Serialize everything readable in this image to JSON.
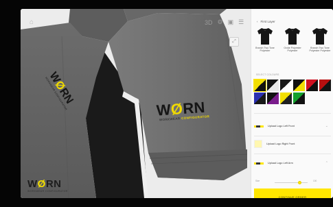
{
  "toolbar": {
    "home_icon": "home-icon",
    "tools": [
      "3D",
      "⚙",
      "▣",
      "☰"
    ],
    "expand_icon": "expand-icon"
  },
  "render": {
    "shirt_color": "#6e6e6e",
    "accent_color": "#1a1a1a",
    "piping_color": "#f2f2f2",
    "logo_main": {
      "name_pre": "W",
      "name_o": "Ø",
      "name_post": "RN",
      "tagline_pre": "WORKWEAR ",
      "tagline_post": "CONFIGURATOR"
    },
    "logo_side": {
      "name_pre": "W",
      "name_o": "Ø",
      "name_post": "RN",
      "tagline": "WORKWEAR CONFIGURATOR"
    }
  },
  "brand": {
    "name_pre": "W",
    "name_o": "Ø",
    "name_post": "RN",
    "tagline": "WORKWEAR CONFIGURATOR"
  },
  "panel": {
    "back_icon": "chevron-left-icon",
    "title": "First Layer",
    "styles": [
      {
        "label": "Branch Two Tone Polyester"
      },
      {
        "label": "Oxide Polyester Polyester"
      },
      {
        "label": "Branch Two Tone Polyester Polyester"
      }
    ],
    "colour_section_label": "SELECT COLOURS",
    "swatches": [
      {
        "a": "#f2de00",
        "b": "#111111"
      },
      {
        "a": "#111111",
        "b": "#e8e8e8"
      },
      {
        "a": "#1a1a1a",
        "b": "#ffffff"
      },
      {
        "a": "#111111",
        "b": "#f2de00"
      },
      {
        "a": "#d01020",
        "b": "#111111"
      },
      {
        "a": "#b81010",
        "b": "#141414"
      },
      {
        "a": "#2b2fb0",
        "b": "#181818"
      },
      {
        "a": "#111111",
        "b": "#7a1c8c"
      },
      {
        "a": "#f2de00",
        "b": "#202020"
      },
      {
        "a": "#14a02c",
        "b": "#111111"
      }
    ],
    "uploads": [
      {
        "label": "Upload Logo Left Front"
      },
      {
        "label": "Upload Logo Right Front"
      },
      {
        "label": "Upload Logo Left Arm"
      }
    ],
    "slider": {
      "label": "Size",
      "value": "100",
      "level": 0.75
    },
    "cta_label": "CONTINUE ORDER"
  }
}
